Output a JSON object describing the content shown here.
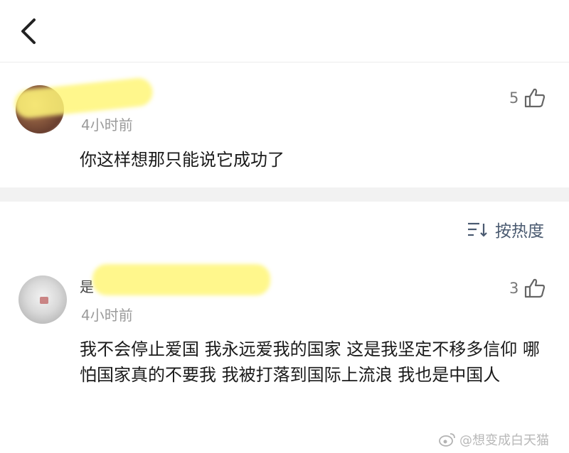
{
  "header": {
    "back_icon": "chevron-left-icon"
  },
  "comments": [
    {
      "time": "4小时前",
      "likes": "5",
      "text": "你这样想那只能说它成功了"
    },
    {
      "name_hint": "是",
      "time": "4小时前",
      "likes": "3",
      "text": "我不会停止爱国 我永远爱我的国家 这是我坚定不移多信仰 哪怕国家真的不要我 我被打落到国际上流浪 我也是中国人"
    }
  ],
  "sort": {
    "label": "按热度",
    "icon": "sort-icon"
  },
  "watermark": {
    "text": "@想变成白天猫",
    "icon": "weibo-icon"
  },
  "colors": {
    "highlight": "#fff678",
    "meta": "#9a9a9a",
    "sort": "#4a5a70"
  }
}
